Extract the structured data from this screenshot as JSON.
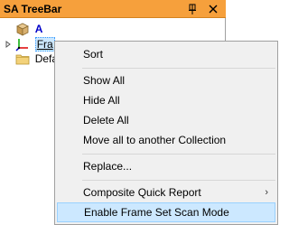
{
  "panel": {
    "title": "SA TreeBar",
    "pin_glyph": "⍑",
    "close_glyph": "✕"
  },
  "tree": {
    "root_label": "A",
    "frame_label": "Fra",
    "default_label": "Defau"
  },
  "context_menu": {
    "items": [
      {
        "label": "Sort"
      },
      {
        "label": "Show All"
      },
      {
        "label": "Hide All"
      },
      {
        "label": "Delete All"
      },
      {
        "label": "Move all to another Collection"
      },
      {
        "label": "Replace..."
      },
      {
        "label": "Composite Quick Report",
        "submenu_glyph": "›"
      },
      {
        "label": "Enable Frame Set Scan Mode"
      }
    ]
  },
  "colors": {
    "titlebar": "#f6a03c",
    "menu_background": "#f0f0f0",
    "highlight": "#cce8ff",
    "root_label": "#0000c8"
  }
}
